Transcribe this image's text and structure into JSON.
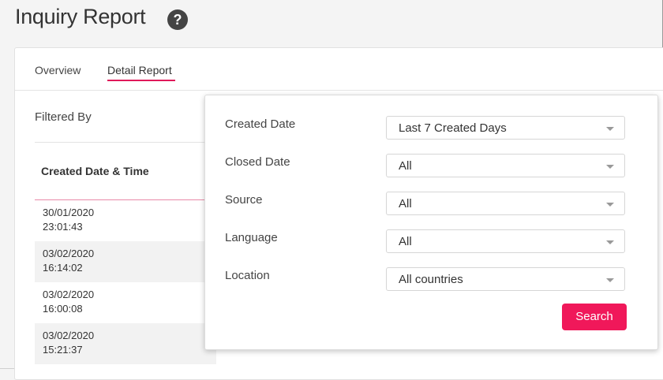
{
  "header": {
    "title": "Inquiry Report",
    "help_icon": "help-icon"
  },
  "tabs": [
    {
      "label": "Overview",
      "active": false
    },
    {
      "label": "Detail Report",
      "active": true
    }
  ],
  "filters_label": "Filtered By",
  "table": {
    "columns": [
      "Created Date & Time"
    ],
    "rows": [
      {
        "date": "30/01/2020",
        "time": "23:01:43"
      },
      {
        "date": "03/02/2020",
        "time": "16:14:02"
      },
      {
        "date": "03/02/2020",
        "time": "16:00:08"
      },
      {
        "date": "03/02/2020",
        "time": "15:21:37"
      }
    ]
  },
  "filter_panel": {
    "fields": [
      {
        "label": "Created Date",
        "value": "Last 7 Created Days"
      },
      {
        "label": "Closed Date",
        "value": "All"
      },
      {
        "label": "Source",
        "value": "All"
      },
      {
        "label": "Language",
        "value": "All"
      },
      {
        "label": "Location",
        "value": "All countries"
      }
    ],
    "search_label": "Search"
  },
  "colors": {
    "accent": "#f0185a",
    "tab_underline": "#e0195a",
    "header_line": "#e88aa8"
  }
}
